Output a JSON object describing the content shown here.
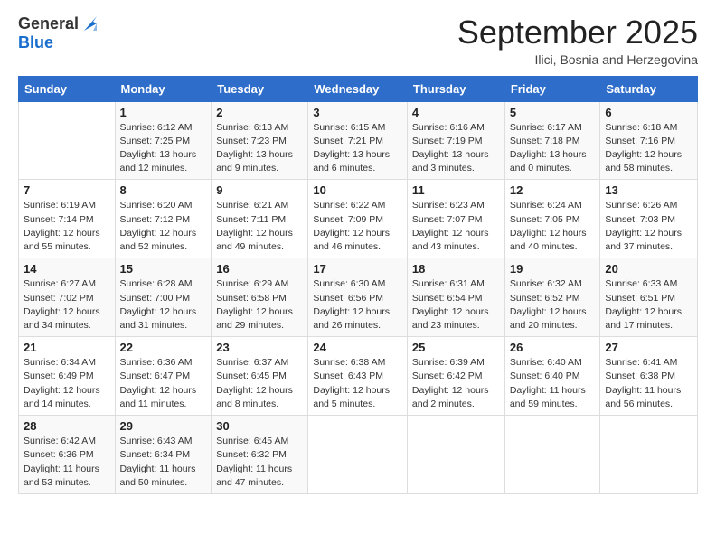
{
  "header": {
    "logo_general": "General",
    "logo_blue": "Blue",
    "month_title": "September 2025",
    "location": "Ilici, Bosnia and Herzegovina"
  },
  "weekdays": [
    "Sunday",
    "Monday",
    "Tuesday",
    "Wednesday",
    "Thursday",
    "Friday",
    "Saturday"
  ],
  "weeks": [
    [
      {
        "day": "",
        "info": ""
      },
      {
        "day": "1",
        "info": "Sunrise: 6:12 AM\nSunset: 7:25 PM\nDaylight: 13 hours\nand 12 minutes."
      },
      {
        "day": "2",
        "info": "Sunrise: 6:13 AM\nSunset: 7:23 PM\nDaylight: 13 hours\nand 9 minutes."
      },
      {
        "day": "3",
        "info": "Sunrise: 6:15 AM\nSunset: 7:21 PM\nDaylight: 13 hours\nand 6 minutes."
      },
      {
        "day": "4",
        "info": "Sunrise: 6:16 AM\nSunset: 7:19 PM\nDaylight: 13 hours\nand 3 minutes."
      },
      {
        "day": "5",
        "info": "Sunrise: 6:17 AM\nSunset: 7:18 PM\nDaylight: 13 hours\nand 0 minutes."
      },
      {
        "day": "6",
        "info": "Sunrise: 6:18 AM\nSunset: 7:16 PM\nDaylight: 12 hours\nand 58 minutes."
      }
    ],
    [
      {
        "day": "7",
        "info": "Sunrise: 6:19 AM\nSunset: 7:14 PM\nDaylight: 12 hours\nand 55 minutes."
      },
      {
        "day": "8",
        "info": "Sunrise: 6:20 AM\nSunset: 7:12 PM\nDaylight: 12 hours\nand 52 minutes."
      },
      {
        "day": "9",
        "info": "Sunrise: 6:21 AM\nSunset: 7:11 PM\nDaylight: 12 hours\nand 49 minutes."
      },
      {
        "day": "10",
        "info": "Sunrise: 6:22 AM\nSunset: 7:09 PM\nDaylight: 12 hours\nand 46 minutes."
      },
      {
        "day": "11",
        "info": "Sunrise: 6:23 AM\nSunset: 7:07 PM\nDaylight: 12 hours\nand 43 minutes."
      },
      {
        "day": "12",
        "info": "Sunrise: 6:24 AM\nSunset: 7:05 PM\nDaylight: 12 hours\nand 40 minutes."
      },
      {
        "day": "13",
        "info": "Sunrise: 6:26 AM\nSunset: 7:03 PM\nDaylight: 12 hours\nand 37 minutes."
      }
    ],
    [
      {
        "day": "14",
        "info": "Sunrise: 6:27 AM\nSunset: 7:02 PM\nDaylight: 12 hours\nand 34 minutes."
      },
      {
        "day": "15",
        "info": "Sunrise: 6:28 AM\nSunset: 7:00 PM\nDaylight: 12 hours\nand 31 minutes."
      },
      {
        "day": "16",
        "info": "Sunrise: 6:29 AM\nSunset: 6:58 PM\nDaylight: 12 hours\nand 29 minutes."
      },
      {
        "day": "17",
        "info": "Sunrise: 6:30 AM\nSunset: 6:56 PM\nDaylight: 12 hours\nand 26 minutes."
      },
      {
        "day": "18",
        "info": "Sunrise: 6:31 AM\nSunset: 6:54 PM\nDaylight: 12 hours\nand 23 minutes."
      },
      {
        "day": "19",
        "info": "Sunrise: 6:32 AM\nSunset: 6:52 PM\nDaylight: 12 hours\nand 20 minutes."
      },
      {
        "day": "20",
        "info": "Sunrise: 6:33 AM\nSunset: 6:51 PM\nDaylight: 12 hours\nand 17 minutes."
      }
    ],
    [
      {
        "day": "21",
        "info": "Sunrise: 6:34 AM\nSunset: 6:49 PM\nDaylight: 12 hours\nand 14 minutes."
      },
      {
        "day": "22",
        "info": "Sunrise: 6:36 AM\nSunset: 6:47 PM\nDaylight: 12 hours\nand 11 minutes."
      },
      {
        "day": "23",
        "info": "Sunrise: 6:37 AM\nSunset: 6:45 PM\nDaylight: 12 hours\nand 8 minutes."
      },
      {
        "day": "24",
        "info": "Sunrise: 6:38 AM\nSunset: 6:43 PM\nDaylight: 12 hours\nand 5 minutes."
      },
      {
        "day": "25",
        "info": "Sunrise: 6:39 AM\nSunset: 6:42 PM\nDaylight: 12 hours\nand 2 minutes."
      },
      {
        "day": "26",
        "info": "Sunrise: 6:40 AM\nSunset: 6:40 PM\nDaylight: 11 hours\nand 59 minutes."
      },
      {
        "day": "27",
        "info": "Sunrise: 6:41 AM\nSunset: 6:38 PM\nDaylight: 11 hours\nand 56 minutes."
      }
    ],
    [
      {
        "day": "28",
        "info": "Sunrise: 6:42 AM\nSunset: 6:36 PM\nDaylight: 11 hours\nand 53 minutes."
      },
      {
        "day": "29",
        "info": "Sunrise: 6:43 AM\nSunset: 6:34 PM\nDaylight: 11 hours\nand 50 minutes."
      },
      {
        "day": "30",
        "info": "Sunrise: 6:45 AM\nSunset: 6:32 PM\nDaylight: 11 hours\nand 47 minutes."
      },
      {
        "day": "",
        "info": ""
      },
      {
        "day": "",
        "info": ""
      },
      {
        "day": "",
        "info": ""
      },
      {
        "day": "",
        "info": ""
      }
    ]
  ]
}
